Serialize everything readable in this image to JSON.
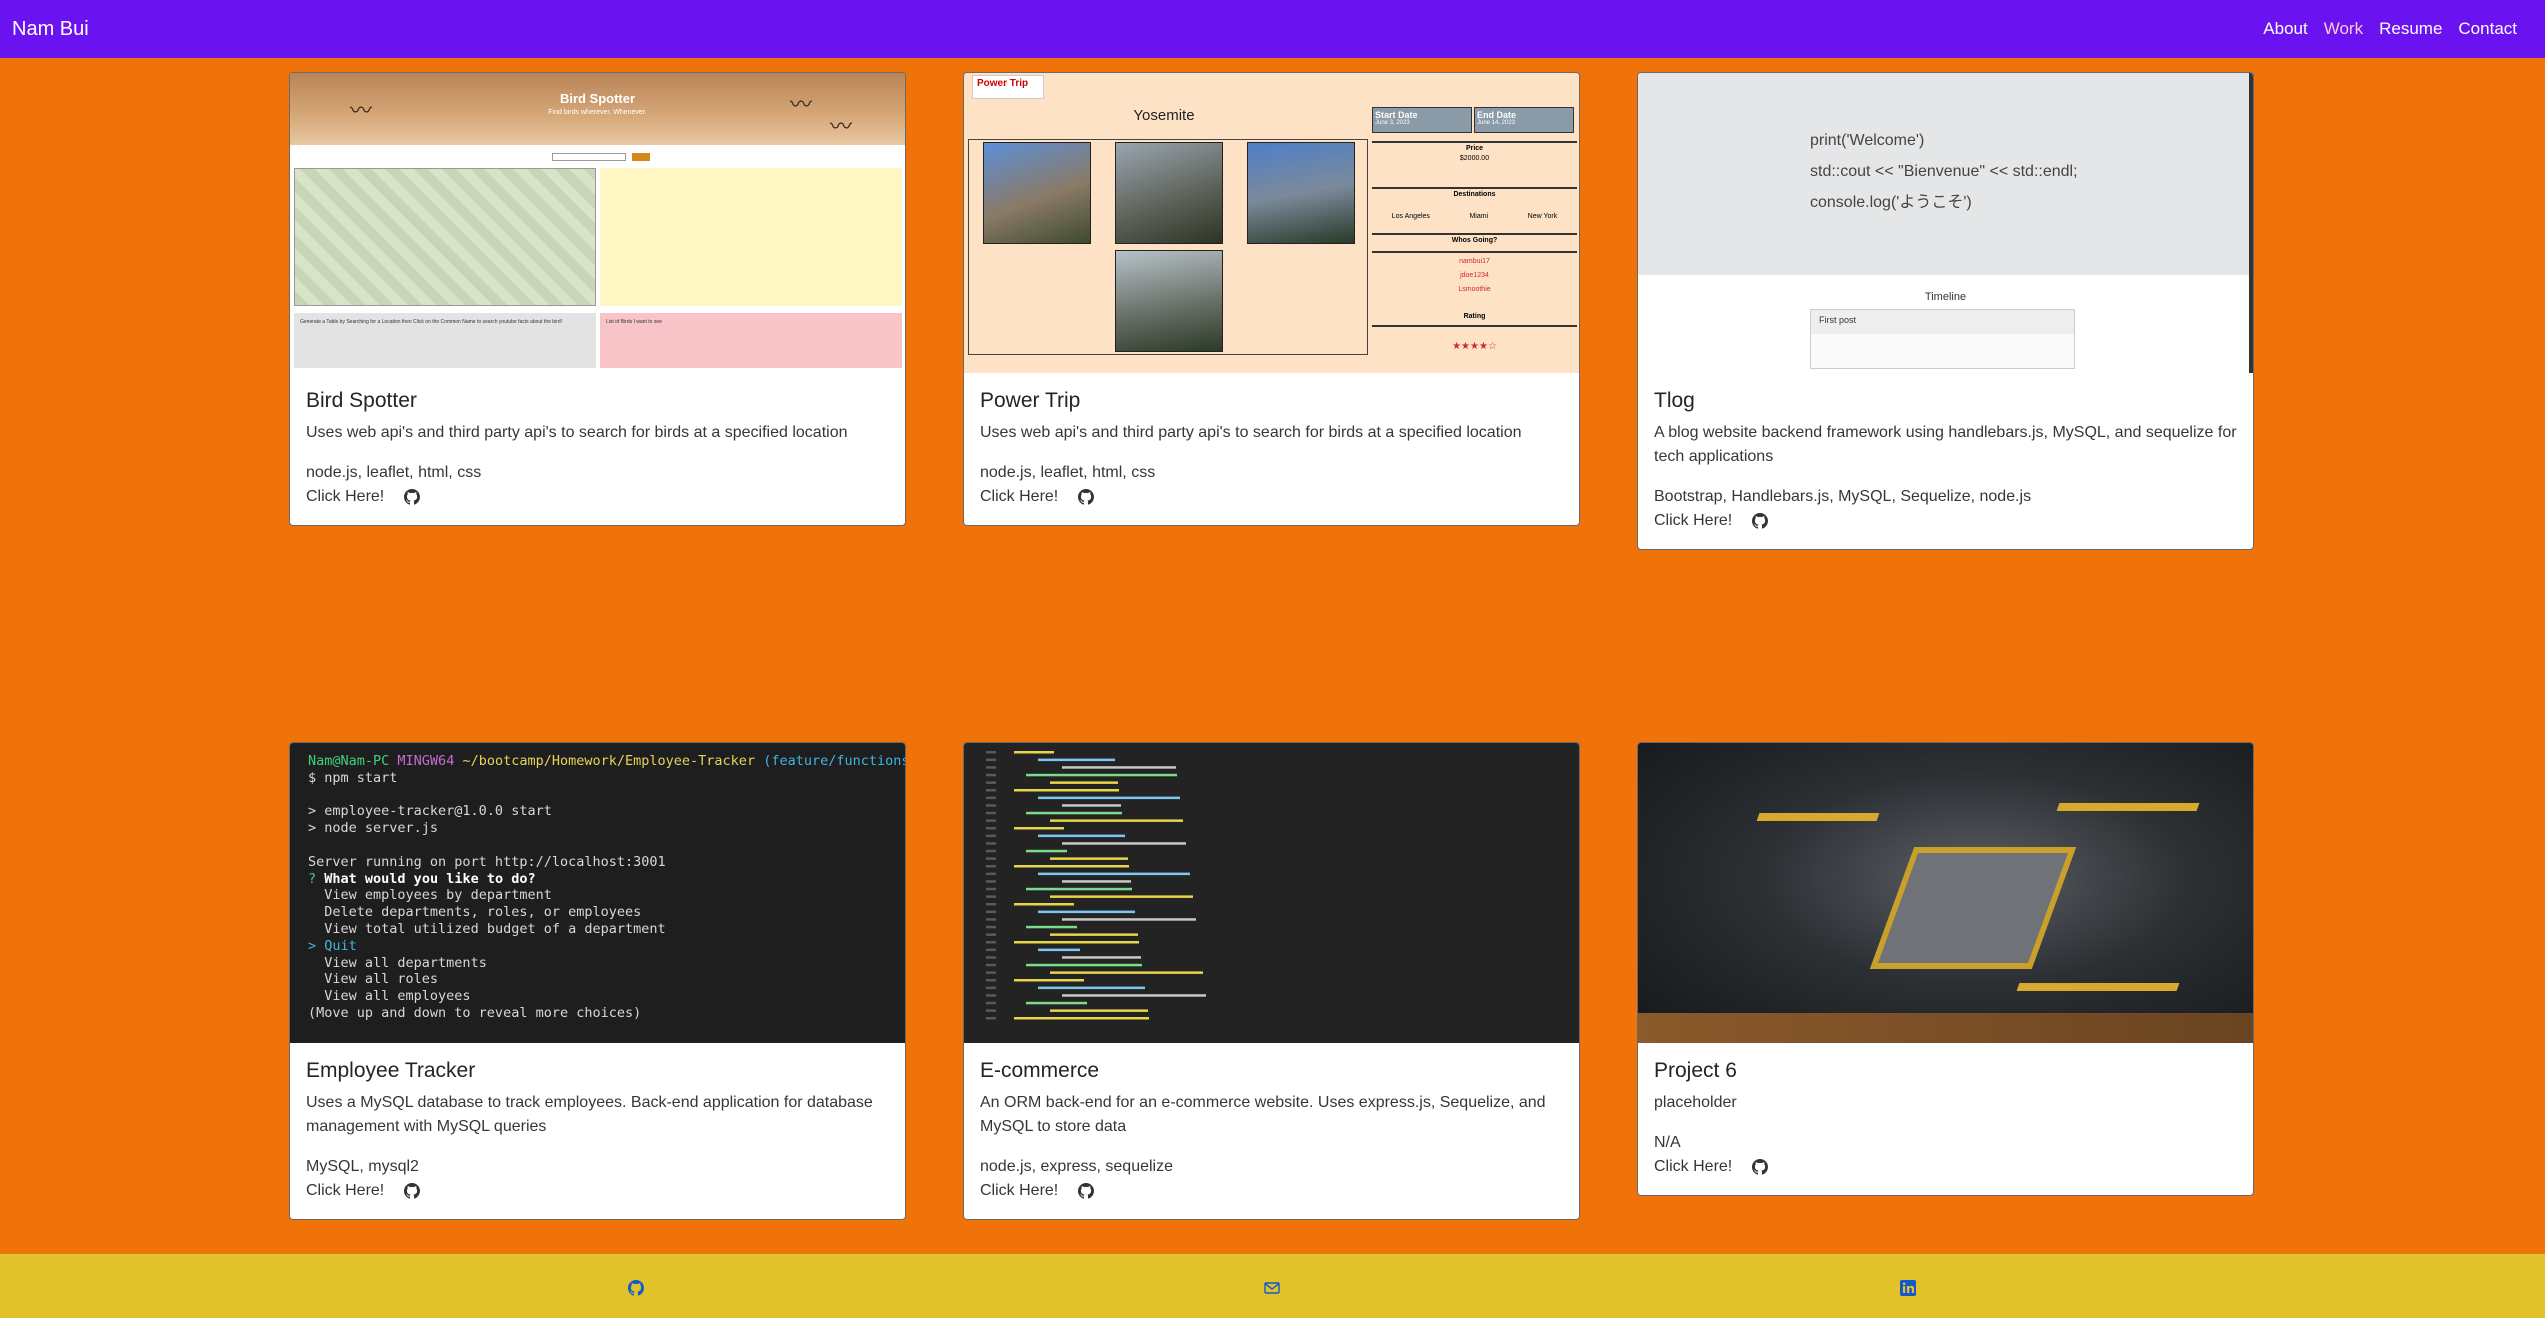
{
  "navbar": {
    "brand": "Nam Bui",
    "links": [
      "About",
      "Work",
      "Resume",
      "Contact"
    ],
    "active": "Work",
    "colors": {
      "background": "#6b12f0",
      "active_link": "#ffc8d6"
    }
  },
  "page": {
    "background": "#f0730a"
  },
  "projects": [
    {
      "title": "Bird Spotter",
      "description": "Uses web api's and third party api's to search for birds at a specified location",
      "tech": "node.js, leaflet, html, css",
      "link_label": "Click Here!",
      "icon": "github-icon",
      "preview": {
        "title": "Bird Spotter",
        "subtitle": "Find birds wherever. Whenever.",
        "box1_text": "Generate a Table by Searching for a Location then Click on the Common Name to search youtube facts about the bird!",
        "box2_text": "List of Birds I want to see"
      }
    },
    {
      "title": "Power Trip",
      "description": "Uses web api's and third party api's to search for birds at a specified location",
      "tech": "node.js, leaflet, html, css",
      "link_label": "Click Here!",
      "icon": "github-icon",
      "preview": {
        "logo": "Power Trip",
        "heading": "Yosemite",
        "start_date_label": "Start Date",
        "end_date_label": "End Date",
        "start_date": "June 3, 2023",
        "end_date": "June 14, 2023",
        "price_label": "Price",
        "price": "$2000.00",
        "destinations_label": "Destinations",
        "destinations": [
          "Los Angeles",
          "Miami",
          "New York"
        ],
        "whos_going_label": "Whos Going?",
        "people": [
          "nambui17",
          "jdoe1234",
          "Lsmoothie"
        ],
        "rating_label": "Rating",
        "rating": "★★★★☆"
      }
    },
    {
      "title": "Tlog",
      "description": "A blog website backend framework using handlebars.js, MySQL, and sequelize for tech applications",
      "tech": "Bootstrap, Handlebars.js, MySQL, Sequelize, node.js",
      "link_label": "Click Here!",
      "icon": "github-icon",
      "preview": {
        "code_lines": [
          "print('Welcome')",
          "std::cout << \"Bienvenue\" << std::endl;",
          "console.log('ようこそ')"
        ],
        "timeline_label": "Timeline",
        "post_title": "First post"
      }
    },
    {
      "title": "Employee Tracker",
      "description": "Uses a MySQL database to track employees. Back-end application for database management with MySQL queries",
      "tech": "MySQL, mysql2",
      "link_label": "Click Here!",
      "icon": "github-icon",
      "preview": {
        "prompt_user": "Nam@Nam-PC",
        "prompt_shell": "MINGW64",
        "prompt_path": "~/bootcamp/Homework/Employee-Tracker",
        "prompt_branch": "(feature/functions)",
        "lines": [
          "$ npm start",
          "",
          "> employee-tracker@1.0.0 start",
          "> node server.js",
          "",
          "Server running on port http://localhost:3001"
        ],
        "question": "What would you like to do?",
        "choices_before": [
          "View employees by department",
          "Delete departments, roles, or employees",
          "View total utilized budget of a department"
        ],
        "selected_choice": "Quit",
        "choices_after": [
          "View all departments",
          "View all roles",
          "View all employees"
        ],
        "hint": "(Move up and down to reveal more choices)"
      }
    },
    {
      "title": "E-commerce",
      "description": "An ORM back-end for an e-commerce website. Uses express.js, Sequelize, and MySQL to store data",
      "tech": "node.js, express, sequelize",
      "link_label": "Click Here!",
      "icon": "github-icon"
    },
    {
      "title": "Project 6",
      "description": "placeholder",
      "tech": "N/A",
      "link_label": "Click Here!",
      "icon": "github-icon"
    }
  ],
  "footer": {
    "background": "#e2c22b",
    "icons": [
      "github-icon",
      "mail-icon",
      "linkedin-icon"
    ]
  }
}
